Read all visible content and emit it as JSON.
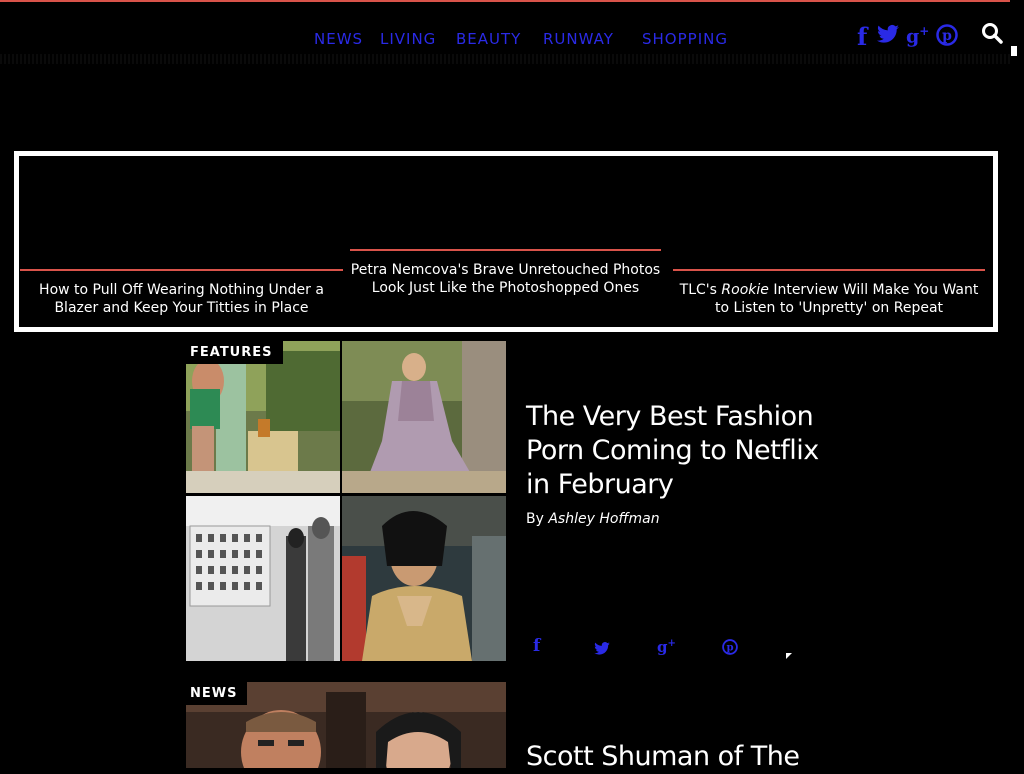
{
  "nav": {
    "items": [
      {
        "label": "NEWS"
      },
      {
        "label": "LIVING"
      },
      {
        "label": "BEAUTY"
      },
      {
        "label": "RUNWAY"
      },
      {
        "label": "SHOPPING"
      }
    ],
    "social_icons": [
      "facebook-icon",
      "twitter-icon",
      "google-plus-icon",
      "pinterest-icon"
    ],
    "search_icon": "search-icon"
  },
  "featured": [
    {
      "title": "How to Pull Off Wearing Nothing Under a Blazer and Keep Your Titties in Place"
    },
    {
      "title": "Petra Nemcova's Brave Unretouched Photos Look Just Like the Photoshopped Ones"
    },
    {
      "title_prefix": "TLC's ",
      "title_em": "Rookie",
      "title_suffix": " Interview Will Make You Want to Listen to 'Unpretty' on Repeat"
    }
  ],
  "articles": [
    {
      "tag": "FEATURES",
      "title": "The Very Best Fashion Porn Coming to Netflix in February",
      "byline_prefix": "By ",
      "author": "Ashley Hoffman",
      "share_icons": [
        "facebook-icon",
        "twitter-icon",
        "google-plus-icon",
        "pinterest-icon"
      ]
    },
    {
      "tag": "NEWS",
      "title": "Scott Shuman of The"
    }
  ],
  "colors": {
    "accent": "#2a2ae6",
    "divider": "#d9534a",
    "background": "#000000"
  }
}
